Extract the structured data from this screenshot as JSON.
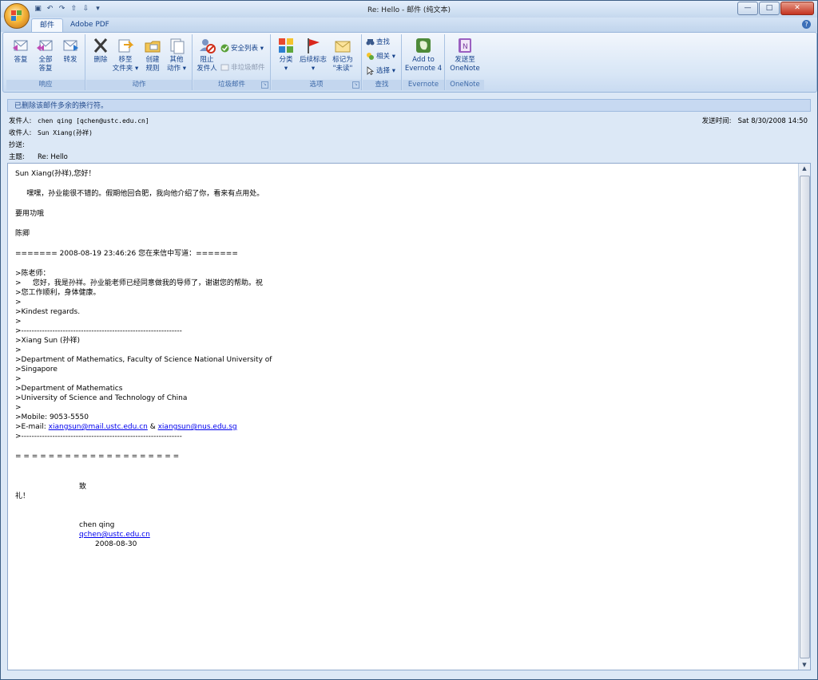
{
  "window": {
    "title": "Re: Hello - 邮件 (纯文本)"
  },
  "qat": [
    "save-icon",
    "undo-icon",
    "redo-icon",
    "prev-icon",
    "next-icon",
    "customize-icon"
  ],
  "tabs": [
    {
      "label": "邮件"
    },
    {
      "label": "Adobe PDF"
    }
  ],
  "ribbon": {
    "groups": {
      "respond": "响应",
      "actions": "动作",
      "junk": "垃圾邮件",
      "options": "选项",
      "find": "查找",
      "evernote": "Evernote",
      "onenote": "OneNote"
    },
    "buttons": {
      "reply": "答复",
      "reply_all_1": "全部",
      "reply_all_2": "答复",
      "forward": "转发",
      "delete": "删除",
      "move_1": "移至",
      "move_2": "文件夹 ▾",
      "rules_1": "创建",
      "rules_2": "规则",
      "other_1": "其他",
      "other_2": "动作 ▾",
      "block_1": "阻止",
      "block_2": "发件人",
      "safe_lists": "安全列表 ▾",
      "not_junk": "非垃圾邮件",
      "categorize_1": "分类",
      "categorize_2": "▾",
      "followup_1": "后续标志",
      "followup_2": "▾",
      "mark_1": "标记为",
      "mark_2": "\"未读\"",
      "find": "查找",
      "related": "相关 ▾",
      "select": "选择 ▾",
      "evernote_1": "Add to",
      "evernote_2": "Evernote 4",
      "onenote_1": "发送至",
      "onenote_2": "OneNote"
    }
  },
  "infobar": "已删除该邮件多余的换行符。",
  "header": {
    "from_label": "发件人:",
    "from": "chen qing [qchen@ustc.edu.cn]",
    "to_label": "收件人:",
    "to": "Sun Xiang(孙祥)",
    "cc_label": "抄送:",
    "cc": "",
    "subject_label": "主题:",
    "subject": "Re: Hello",
    "sent_label": "发送时间:",
    "sent": "Sat 8/30/2008 14:50"
  },
  "message": {
    "greeting": "Sun Xiang(孙祥),您好！",
    "p1": "     嘿嘿，孙业能很不错的。假期他回合肥，我向他介绍了你，看来有点用处。",
    "p2": "要用功哦",
    "p3": "陈卿",
    "quote_header": "======= 2008-08-19 23:46:26 您在来信中写道：=======",
    "q1": ">陈老师：",
    "q2": ">     您好，我是孙祥。孙业能老师已经同意做我的导师了，谢谢您的帮助。祝",
    "q3": ">您工作顺利，身体健康。",
    "q4": ">",
    "q5": ">Kindest regards.",
    "q6": ">",
    "q7": ">--------------------------------------------------------------",
    "q8": ">Xiang Sun (孙祥)",
    "q9": ">",
    "q10": ">Department of Mathematics, Faculty of Science National University of",
    "q11": ">Singapore",
    "q12": ">",
    "q13": ">Department of Mathematics",
    "q14": ">University of Science and Technology of China",
    "q15": ">",
    "q16": ">Mobile: 9053-5550",
    "q17_prefix": ">E-mail: ",
    "q17_link1": "xiangsun@mail.ustc.edu.cn",
    "q17_amp": " & ",
    "q17_link2": "xiangsun@nus.edu.sg",
    "q18": ">--------------------------------------------------------------",
    "separator": "= = = = = = = = = = = = = = = = = = = =",
    "closing1": "致",
    "closing2": "礼！",
    "sig_name": "chen qing",
    "sig_email": "qchen@ustc.edu.cn",
    "sig_date": "2008-08-30"
  }
}
